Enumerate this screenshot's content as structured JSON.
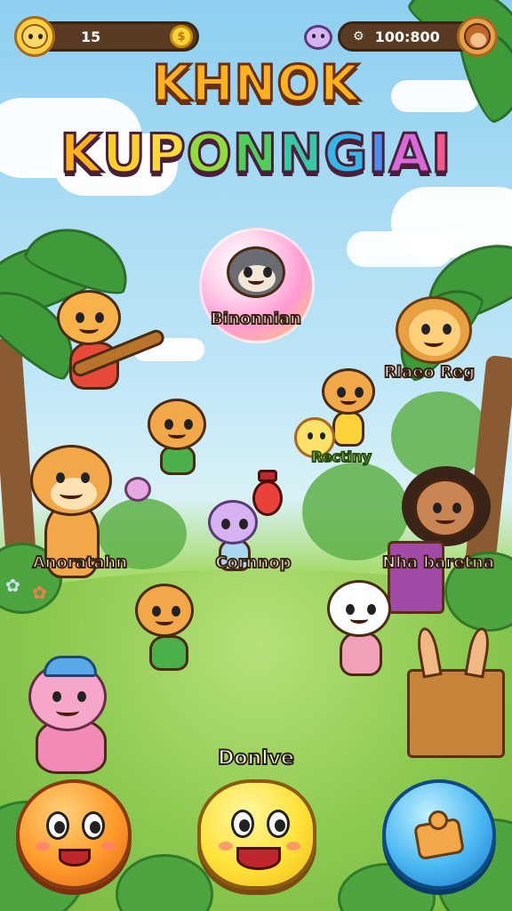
{
  "hud": {
    "left_value": "15",
    "left_avatar_icon": "lion-avatar-icon",
    "left_coin_icon": "coin-icon",
    "right_value": "100:800",
    "right_icon": "settings-cog-icon",
    "right_avatar_icon": "girl-avatar-icon"
  },
  "title": {
    "line1": "KHNOK",
    "line2_letters": [
      "K",
      "U",
      "P",
      "O",
      "N",
      "N",
      "G",
      "I",
      "A",
      "I"
    ],
    "line2_colors": [
      "#ffb21f",
      "#ffcf2a",
      "#ffd93a",
      "#8fdc3a",
      "#4fcf5a",
      "#3ac7a6",
      "#36b6e8",
      "#4f8ef0",
      "#d86ad8",
      "#f25a8a"
    ]
  },
  "characters": {
    "featured_label": "Binonnian",
    "guitar_cat_label": "",
    "lion_right_label": "Rlaeo Reg",
    "bear_small_label": "",
    "sun_label": "Rectiny",
    "tiger_left_label": "Anoratahn",
    "purple_label": "Cornnop",
    "girl_label": "Nha baretna",
    "pink_cat_label": "",
    "cat_bottom_label": "",
    "white_cat_label": ""
  },
  "bottom": {
    "center_label": "Donlve",
    "left_button_icon": "orange-face-icon",
    "center_button_icon": "yellow-smiley-icon",
    "right_button_icon": "puzzle-piece-icon"
  },
  "colors": {
    "sky": "#8ecff0",
    "grass": "#86c84f",
    "hud_bar": "#5a3a22"
  }
}
